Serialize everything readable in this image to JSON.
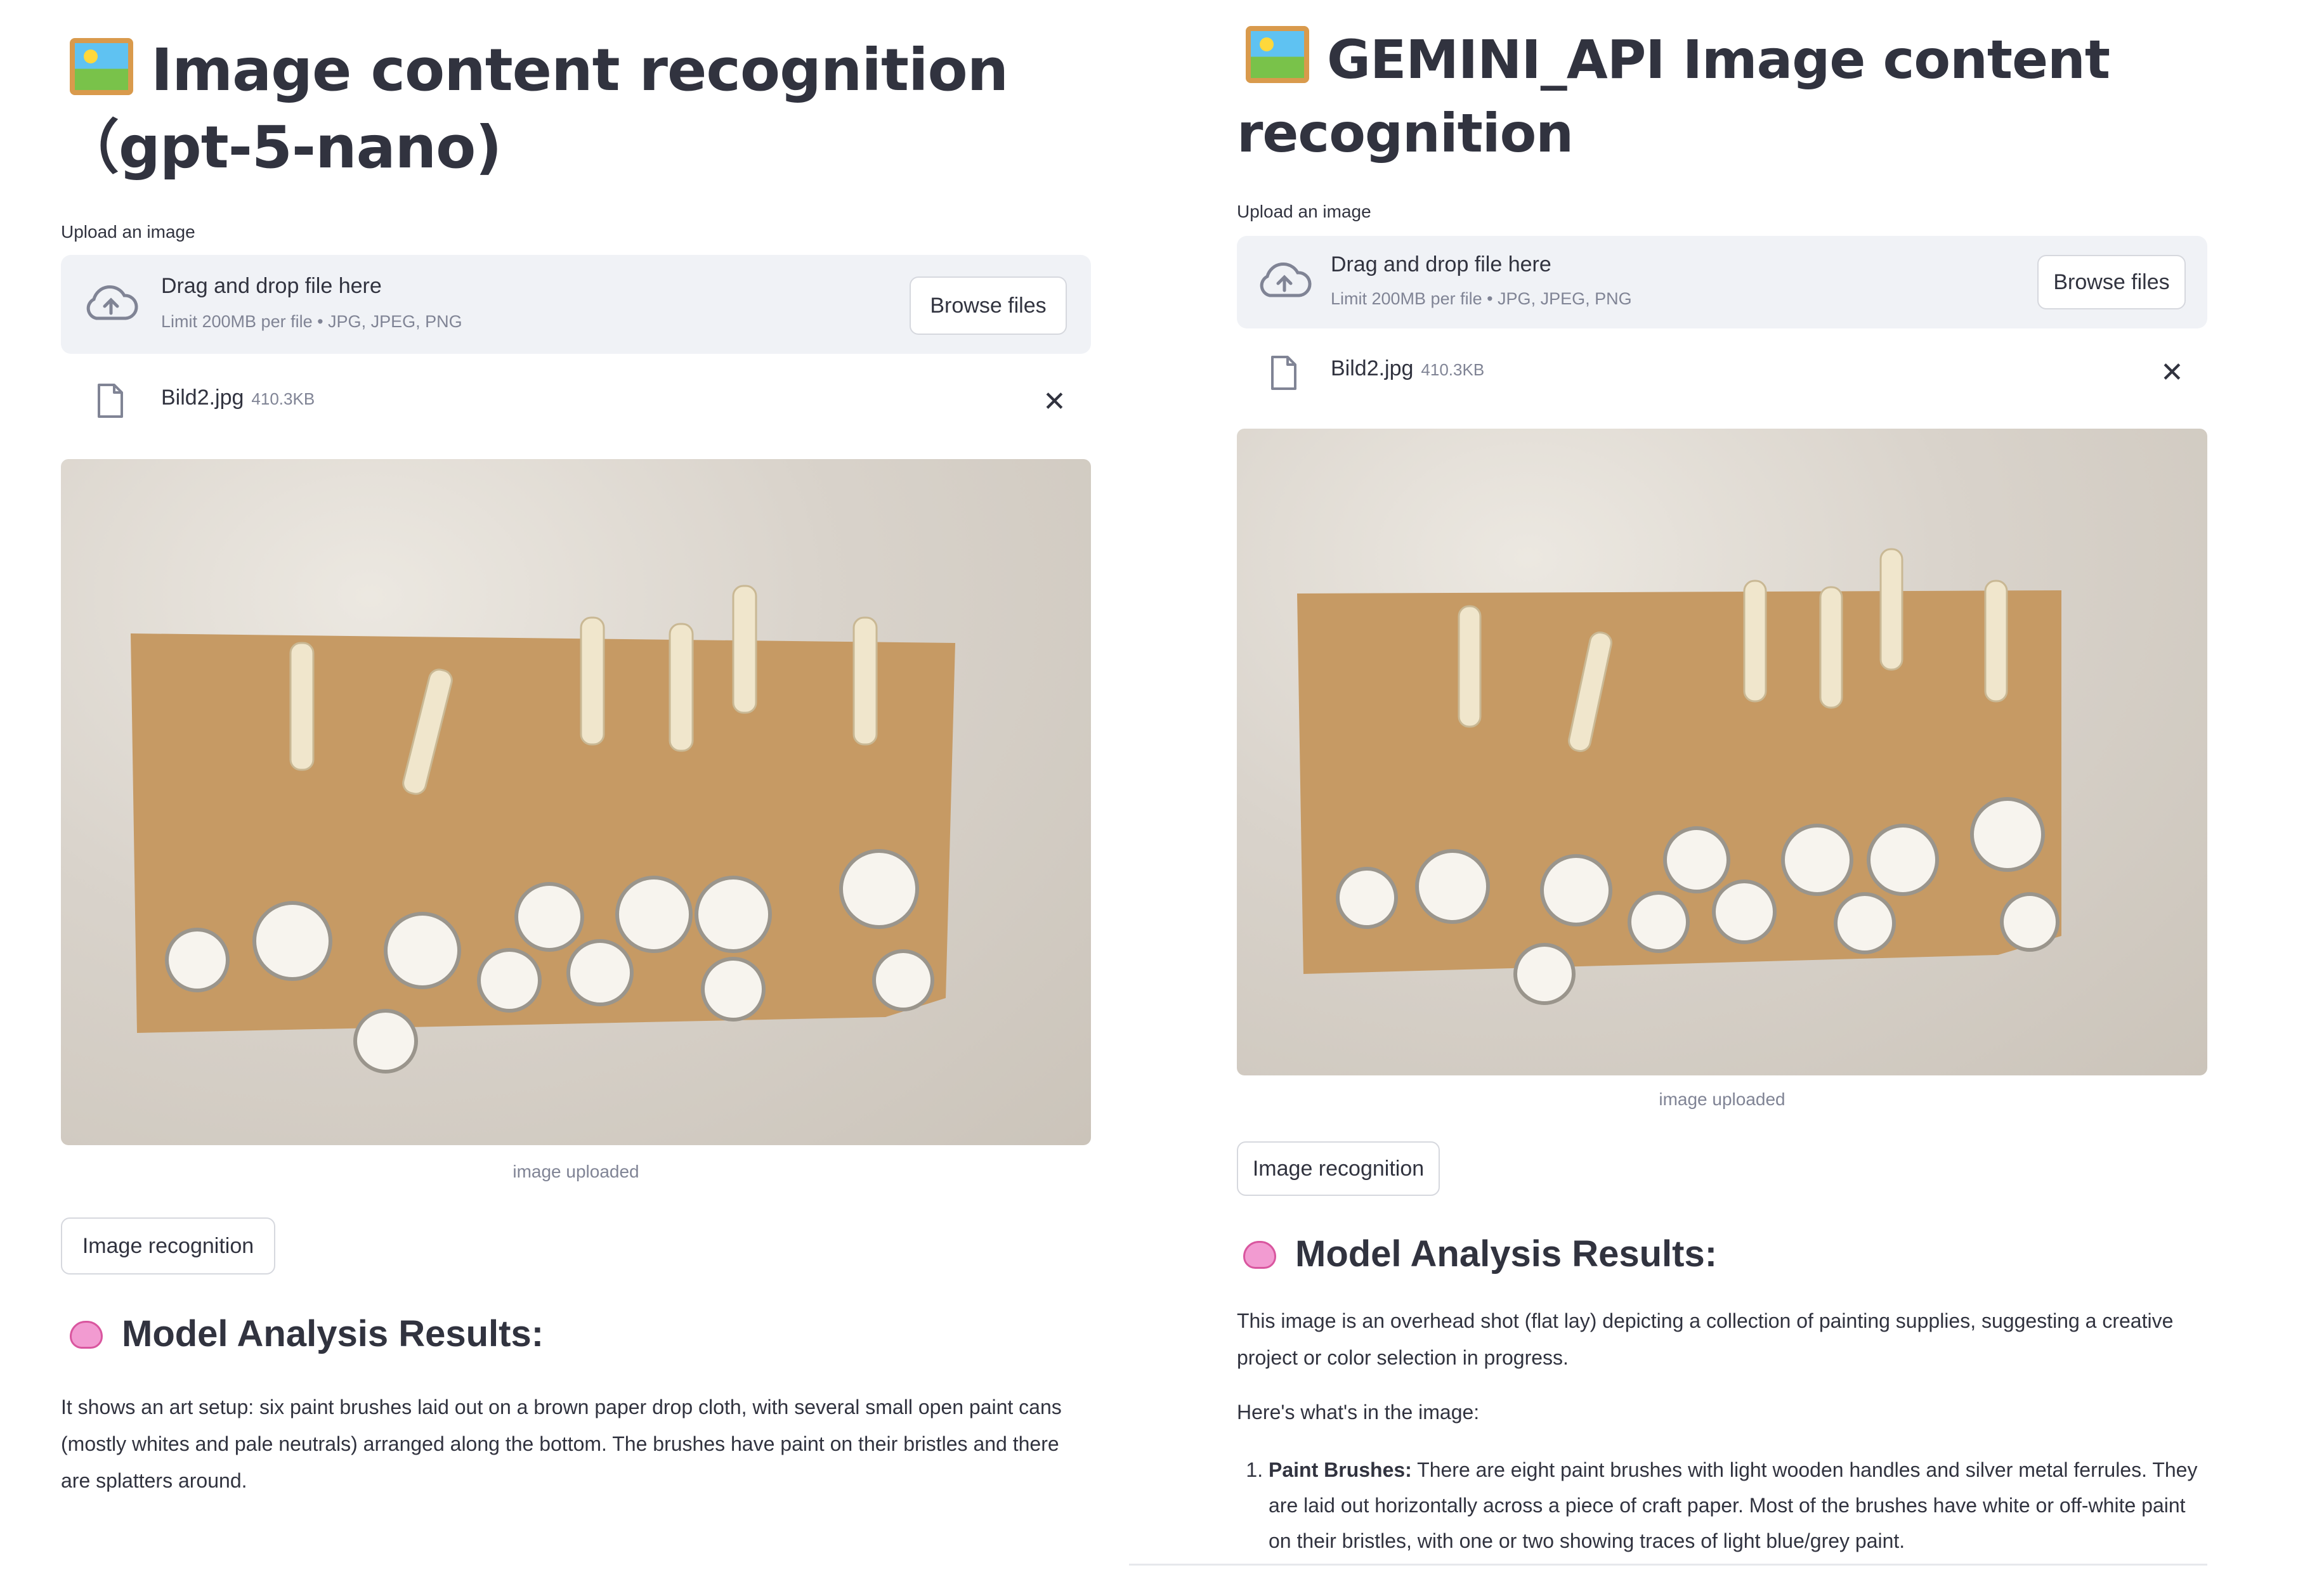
{
  "left": {
    "title": "Image content recognition（gpt-5-nano)",
    "upload_label": "Upload an image",
    "dropzone": {
      "main": "Drag and drop file here",
      "sub": "Limit 200MB per file • JPG, JPEG, PNG",
      "browse_label": "Browse files"
    },
    "file": {
      "name": "Bild2.jpg",
      "size": "410.3KB"
    },
    "caption": "image uploaded",
    "recognize_label": "Image recognition",
    "results_heading": "Model Analysis Results:",
    "result_text": "It shows an art setup: six paint brushes laid out on a brown paper drop cloth, with several small open paint cans (mostly whites and pale neutrals) arranged along the bottom. The brushes have paint on their bristles and there are splatters around."
  },
  "right": {
    "title": "GEMINI_API Image content recognition",
    "upload_label": "Upload an image",
    "dropzone": {
      "main": "Drag and drop file here",
      "sub": "Limit 200MB per file • JPG, JPEG, PNG",
      "browse_label": "Browse files"
    },
    "file": {
      "name": "Bild2.jpg",
      "size": "410.3KB"
    },
    "caption": "image uploaded",
    "recognize_label": "Image recognition",
    "results_heading": "Model Analysis Results:",
    "intro": "This image is an overhead shot (flat lay) depicting a collection of painting supplies, suggesting a creative project or color selection in progress.",
    "lead": "Here's what's in the image:",
    "items": [
      {
        "title": "Paint Brushes:",
        "text": "There are eight paint brushes with light wooden handles and silver metal ferrules. They are laid out horizontally across a piece of craft paper. Most of the brushes have white or off-white paint on their bristles, with one or two showing traces of light blue/grey paint."
      }
    ]
  },
  "icons": {
    "title_emoji": "framed-picture-icon",
    "results_emoji": "brain-icon",
    "upload": "cloud-upload-icon",
    "file": "file-icon",
    "remove": "close-icon"
  },
  "colors": {
    "text": "#31333f",
    "muted": "#808495",
    "dropzone_bg": "#f0f2f6",
    "border": "#d6d8de",
    "kraft_paper": "#c69a64",
    "drop_cloth": "#d9d3cb"
  }
}
